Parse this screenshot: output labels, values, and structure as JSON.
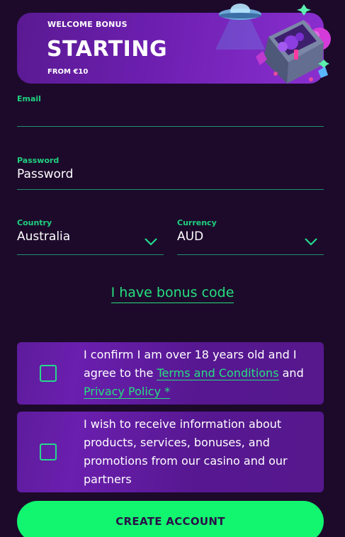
{
  "banner": {
    "kicker": "WELCOME BONUS",
    "title": "STARTING",
    "subtitle": "FROM €10"
  },
  "form": {
    "email": {
      "label": "Email",
      "value": ""
    },
    "password": {
      "label": "Password",
      "value": "Password"
    },
    "country": {
      "label": "Country",
      "value": "Australia"
    },
    "currency": {
      "label": "Currency",
      "value": "AUD"
    }
  },
  "bonus_link": "I have bonus code",
  "consent_age": {
    "text_before": "I confirm I am over 18 years old and I agree to the ",
    "terms_link": "Terms and Conditions",
    "text_mid": " and ",
    "privacy_link": "Privacy Policy *",
    "checked": false
  },
  "consent_marketing": {
    "text": "I wish to receive information about products, services, bonuses, and promotions from our casino and our partners",
    "checked": false
  },
  "create_button": "CREATE ACCOUNT",
  "colors": {
    "background": "#1d0a2b",
    "accent_green": "#12f56f",
    "label_green": "#1fd07f",
    "card_purple": "#5e1c9c"
  },
  "icons": {
    "chevron": "chevron-down-icon",
    "banner_art": "ufo-treasure-chest-illustration"
  }
}
